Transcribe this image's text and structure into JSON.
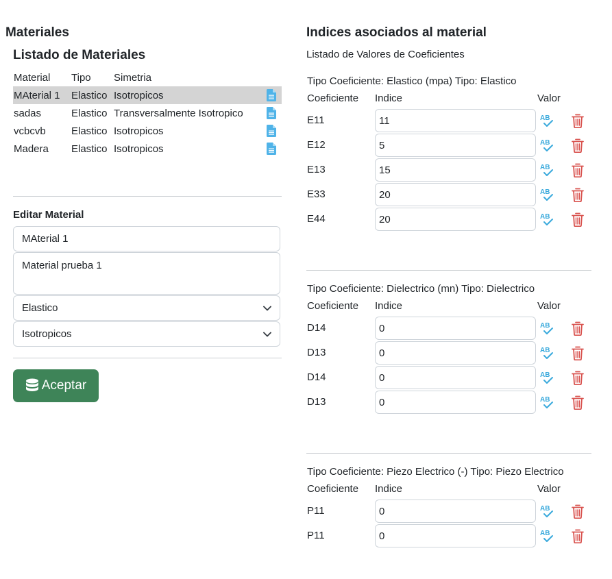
{
  "left": {
    "page_title": "Materiales",
    "list_title": "Listado de Materiales",
    "columns": [
      "Material",
      "Tipo",
      "Simetria"
    ],
    "rows": [
      {
        "material": "MAterial 1",
        "tipo": "Elastico",
        "simetria": "Isotropicos",
        "selected": true
      },
      {
        "material": "sadas",
        "tipo": "Elastico",
        "simetria": "Transversalmente Isotropico",
        "selected": false
      },
      {
        "material": "vcbcvb",
        "tipo": "Elastico",
        "simetria": "Isotropicos",
        "selected": false
      },
      {
        "material": "Madera",
        "tipo": "Elastico",
        "simetria": "Isotropicos",
        "selected": false
      }
    ],
    "row_icon": "document-icon",
    "edit": {
      "label": "Editar Material",
      "name_value": "MAterial 1",
      "description_value": "Material prueba 1",
      "tipo_selected": "Elastico",
      "simetria_selected": "Isotropicos",
      "accept_label": "Aceptar",
      "accept_icon": "database-icon"
    }
  },
  "right": {
    "title": "Indices asociados al material",
    "subtitle": "Listado de Valores de Coeficientes",
    "header_coef": "Coeficiente",
    "header_indice": "Indice",
    "header_valor": "Valor",
    "groups": [
      {
        "title": "Tipo Coeficiente: Elastico (mpa) Tipo: Elastico",
        "rows": [
          {
            "label": "E11",
            "value": "11"
          },
          {
            "label": "E12",
            "value": "5"
          },
          {
            "label": "E13",
            "value": "15"
          },
          {
            "label": "E33",
            "value": "20"
          },
          {
            "label": "E44",
            "value": "20"
          }
        ]
      },
      {
        "title": "Tipo Coeficiente: Dielectrico (mn) Tipo: Dielectrico",
        "rows": [
          {
            "label": "D14",
            "value": "0"
          },
          {
            "label": "D13",
            "value": "0"
          },
          {
            "label": "D14",
            "value": "0"
          },
          {
            "label": "D13",
            "value": "0"
          }
        ]
      },
      {
        "title": "Tipo Coeficiente: Piezo Electrico (-) Tipo: Piezo Electrico",
        "rows": [
          {
            "label": "P11",
            "value": "0"
          },
          {
            "label": "P11",
            "value": "0"
          }
        ]
      }
    ],
    "row_icons": [
      "spellcheck-icon",
      "trash-icon"
    ],
    "colors": {
      "doc_icon": "#4fb3e8",
      "ab_icon": "#39a9dc",
      "trash_icon": "#d9534f",
      "accept_button": "#3e8458",
      "selected_row": "#d4d4d4"
    }
  }
}
